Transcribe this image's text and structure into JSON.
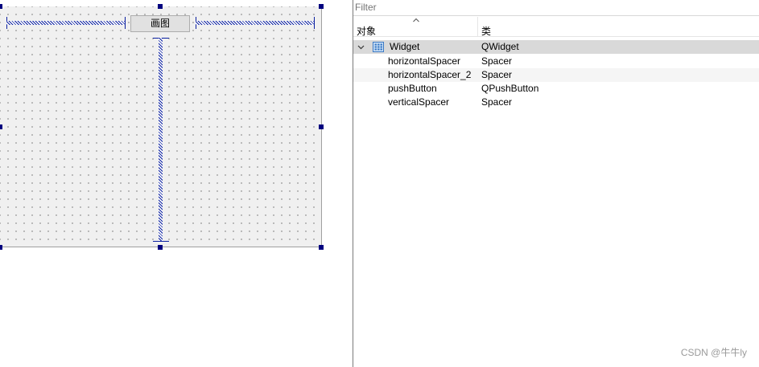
{
  "form": {
    "push_button_label": "画图"
  },
  "inspector": {
    "filter_placeholder": "Filter",
    "columns": {
      "object": "对象",
      "class": "类"
    },
    "root": {
      "name": "Widget",
      "class": "QWidget",
      "icon": "widget-grid-icon",
      "expanded": true
    },
    "children": [
      {
        "name": "horizontalSpacer",
        "class": "Spacer"
      },
      {
        "name": "horizontalSpacer_2",
        "class": "Spacer"
      },
      {
        "name": "pushButton",
        "class": "QPushButton"
      },
      {
        "name": "verticalSpacer",
        "class": "Spacer"
      }
    ]
  },
  "watermark": "CSDN @牛牛ly",
  "colors": {
    "spacer_blue": "#0a1fa0",
    "handle_navy": "#00007f",
    "selected_row": "#d9d9d9",
    "form_bg": "#f0f0f0"
  }
}
